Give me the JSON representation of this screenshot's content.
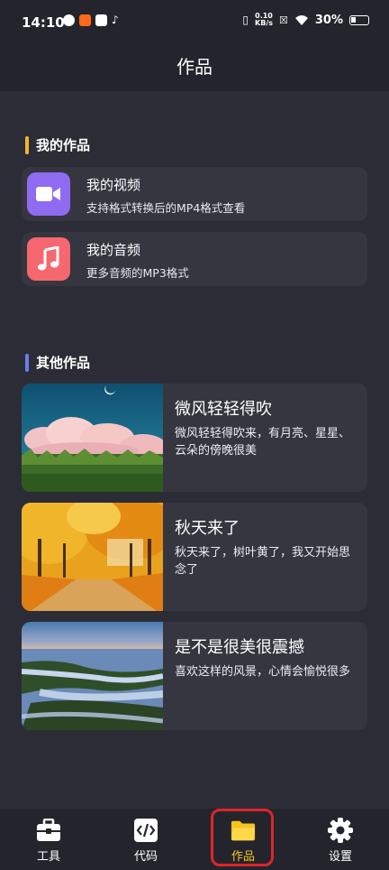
{
  "status_bar": {
    "time": "14:10",
    "net_speed_value": "0.10",
    "net_speed_unit": "KB/s",
    "battery": "30%"
  },
  "header": {
    "title": "作品"
  },
  "my_works": {
    "section_title": "我的作品",
    "accent_color": "#f2b233",
    "items": [
      {
        "title": "我的视频",
        "subtitle": "支持格式转换后的MP4格式查看",
        "icon": "video-icon",
        "color": "#8f6bf2"
      },
      {
        "title": "我的音频",
        "subtitle": "更多音频的MP3格式",
        "icon": "music-note-icon",
        "color": "#f7676f"
      }
    ]
  },
  "other_works": {
    "section_title": "其他作品",
    "accent_color": "#6a7ef0",
    "items": [
      {
        "title": "微风轻轻得吹",
        "desc": "微风轻轻得吹来，有月亮、星星、云朵的傍晚很美"
      },
      {
        "title": "秋天来了",
        "desc": "秋天来了，树叶黄了，我又开始思念了"
      },
      {
        "title": "是不是很美很震撼",
        "desc": "喜欢这样的风景，心情会愉悦很多"
      }
    ]
  },
  "bottom_nav": {
    "items": [
      {
        "label": "工具",
        "icon": "toolbox-icon"
      },
      {
        "label": "代码",
        "icon": "code-icon"
      },
      {
        "label": "作品",
        "icon": "folder-icon",
        "active": true
      },
      {
        "label": "设置",
        "icon": "gear-icon"
      }
    ],
    "active_color": "#f7c51b",
    "highlight_color": "#e0242b"
  }
}
